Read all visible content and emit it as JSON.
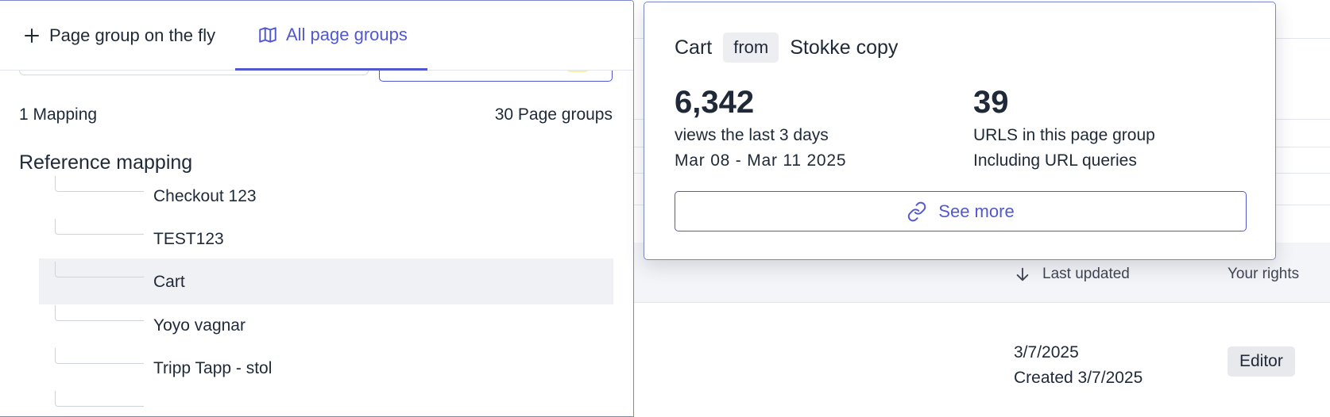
{
  "tabs": {
    "page_group_on_the_fly": "Page group on the fly",
    "all_page_groups": "All page groups"
  },
  "counts": {
    "mappings": "1 Mapping",
    "page_groups": "30 Page groups"
  },
  "reference_mapping": {
    "title": "Reference mapping",
    "items": [
      {
        "label": "Checkout 123"
      },
      {
        "label": "TEST123"
      },
      {
        "label": "Cart",
        "selected": true
      },
      {
        "label": "Yoyo vagnar"
      },
      {
        "label": "Tripp Tapp - stol"
      }
    ]
  },
  "popover": {
    "name": "Cart",
    "from_label": "from",
    "source": "Stokke copy",
    "views": {
      "value": "6,342",
      "caption": "views the last 3 days",
      "range": "Mar 08 - Mar 11 2025"
    },
    "urls": {
      "value": "39",
      "caption": "URLS in this page group",
      "note": "Including URL queries"
    },
    "see_more": "See more"
  },
  "table": {
    "columns": {
      "last_updated": "Last updated",
      "your_rights": "Your rights"
    },
    "row": {
      "updated": "3/7/2025",
      "created": "Created 3/7/2025",
      "rights": "Editor"
    }
  },
  "colors": {
    "accent": "#5258d0",
    "border": "#7b86c9",
    "selected_row": "#f0f1f5",
    "chip": "#eceef1"
  }
}
